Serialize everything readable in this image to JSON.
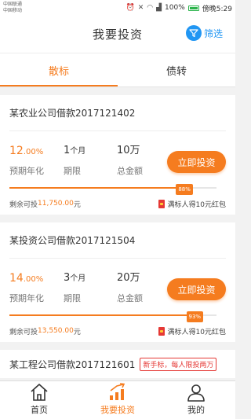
{
  "statusbar": {
    "carrier1": "中国联通",
    "carrier2": "中国移动",
    "battery": "100%",
    "time": "傍晚5:29"
  },
  "header": {
    "title": "我要投资",
    "filter_label": "筛选"
  },
  "tabs": [
    {
      "label": "散标",
      "active": true
    },
    {
      "label": "债转",
      "active": false
    }
  ],
  "loans": [
    {
      "title": "某农业公司借款2017121402",
      "rate": "12",
      "rate_suffix": ".00%",
      "rate_label": "预期年化",
      "term": "1",
      "term_unit": "个月",
      "term_label": "期限",
      "amount": "10万",
      "amount_label": "总金额",
      "button": "立即投资",
      "progress_text": "88%",
      "progress": 0.88,
      "remain_prefix": "剩余可投",
      "remain_amount": "11,750.00",
      "remain_unit": "元",
      "reward": "满标人得10元红包"
    },
    {
      "title": "某投资公司借款2017121504",
      "rate": "14",
      "rate_suffix": ".00%",
      "rate_label": "预期年化",
      "term": "3",
      "term_unit": "个月",
      "term_label": "期限",
      "amount": "20万",
      "amount_label": "总金额",
      "button": "立即投资",
      "progress_text": "93%",
      "progress": 0.93,
      "remain_prefix": "剩余可投",
      "remain_amount": "13,550.00",
      "remain_unit": "元",
      "reward": "满标人得10元红包"
    }
  ],
  "loan3": {
    "title": "某工程公司借款2017121601",
    "badge": "新手标，每人限投两万"
  },
  "bottomnav": [
    {
      "label": "首页",
      "icon": "home-icon",
      "active": false
    },
    {
      "label": "我要投资",
      "icon": "invest-chart-icon",
      "active": true
    },
    {
      "label": "我的",
      "icon": "user-icon",
      "active": false
    }
  ],
  "colors": {
    "accent": "#f57c1f",
    "filter": "#2196f3",
    "badge": "#e53935"
  }
}
